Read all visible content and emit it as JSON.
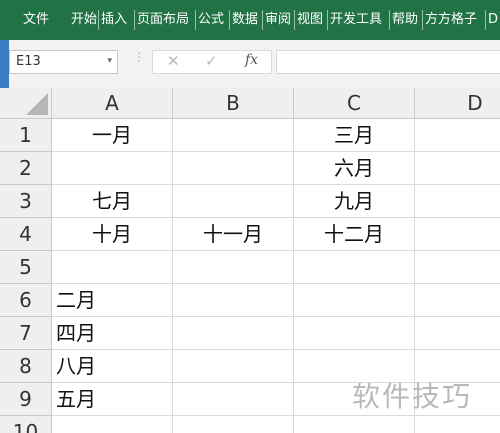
{
  "ribbon": {
    "tabs": [
      "文件",
      "开始",
      "插入",
      "页面布局",
      "公式",
      "数据",
      "审阅",
      "视图",
      "开发工具",
      "帮助",
      "方方格子",
      "D"
    ]
  },
  "formula_bar": {
    "name_box": "E13",
    "name_box_arrow": "▾",
    "dots": "⋮",
    "cancel": "✕",
    "enter": "✓",
    "fx": "fx",
    "formula": ""
  },
  "sheet": {
    "columns": [
      "A",
      "B",
      "C",
      "D"
    ],
    "rows": [
      "1",
      "2",
      "3",
      "4",
      "5",
      "6",
      "7",
      "8",
      "9",
      "10"
    ],
    "cells": {
      "A1": "一月",
      "C1": "三月",
      "C2": "六月",
      "A3": "七月",
      "C3": "九月",
      "A4": "十月",
      "B4": "十一月",
      "C4": "十二月",
      "A6": "二月",
      "A7": "四月",
      "A8": "八月",
      "A9": "五月"
    }
  },
  "watermark": "软件技巧"
}
